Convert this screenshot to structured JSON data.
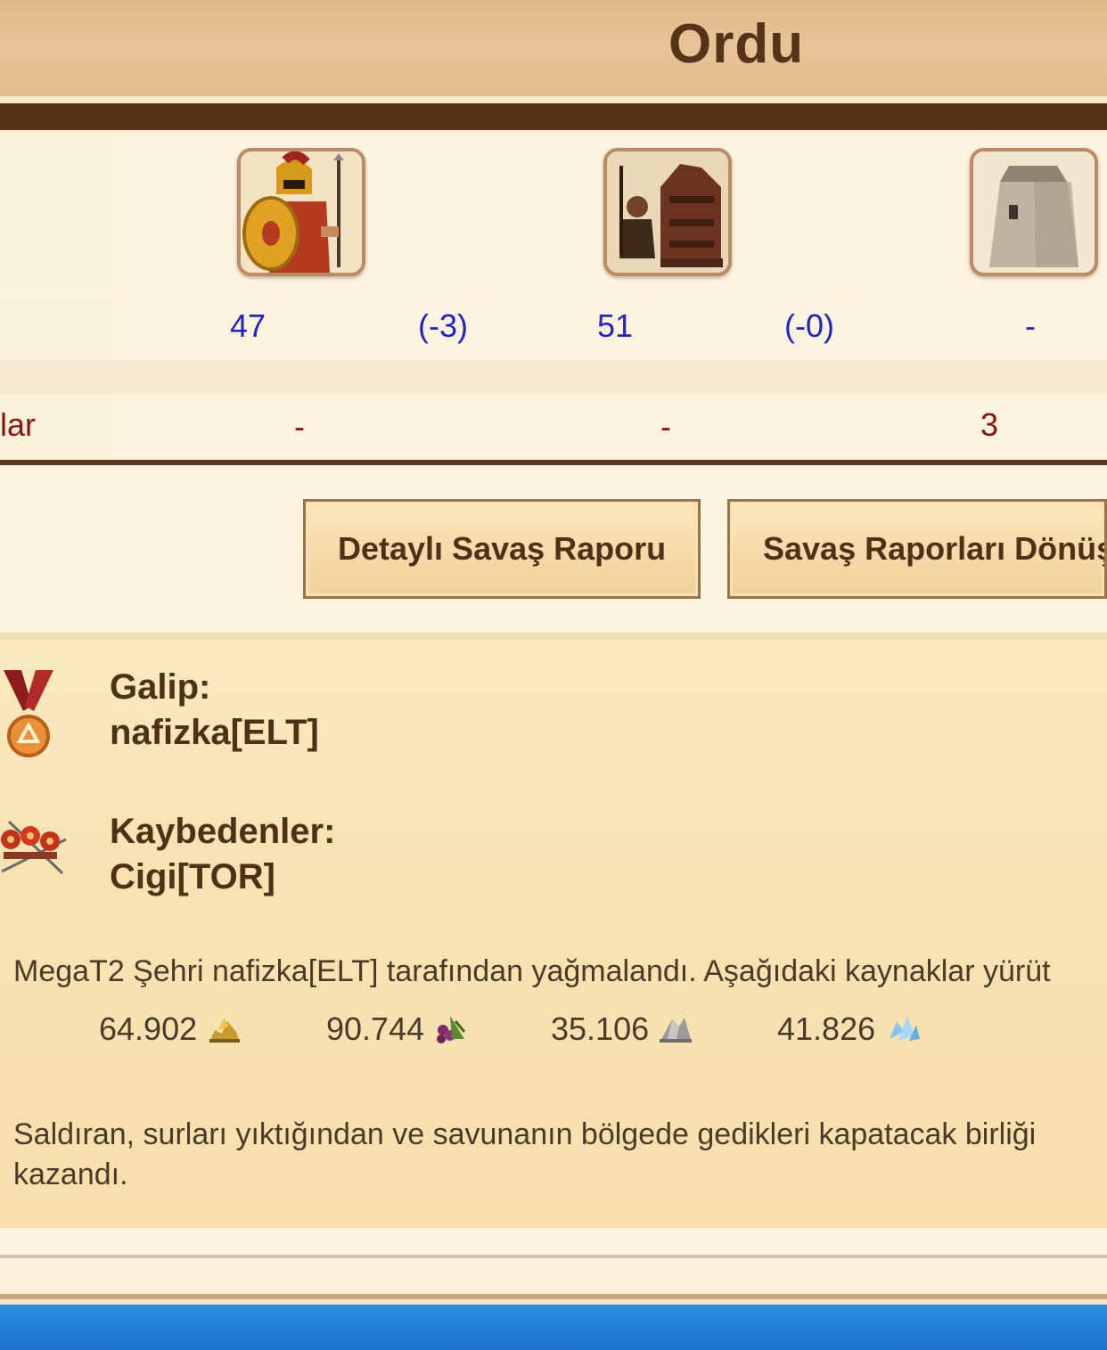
{
  "header": {
    "title": "Ordu"
  },
  "table": {
    "columns": [
      {
        "icon": "spartan-hoplite-icon",
        "count": "47",
        "loss": "(-3)",
        "destroyed": "-"
      },
      {
        "icon": "siege-tower-icon",
        "count": "51",
        "loss": "(-0)",
        "destroyed": "-"
      },
      {
        "icon": "city-wall-icon",
        "count": "-",
        "destroyed": "3"
      }
    ],
    "destroyed_row_label": "lar"
  },
  "buttons": {
    "detailed_report": "Detaylı Savaş Raporu",
    "back_to_reports": "Savaş Raporları Dönüş"
  },
  "result": {
    "winner_label": "Galip:",
    "winner_name": "nafizka[ELT]",
    "winner_icon": "medal-icon",
    "losers_label": "Kaybedenler:",
    "losers_name": "Cigi[TOR]",
    "losers_icon": "fallen-soldiers-icon",
    "plunder_text": "MegaT2 Şehri nafizka[ELT] tarafından yağmalandı. Aşağıdaki kaynaklar yürüt",
    "resources": [
      {
        "value": "64.902",
        "icon": "gold-icon"
      },
      {
        "value": "90.744",
        "icon": "wine-icon"
      },
      {
        "value": "35.106",
        "icon": "marble-icon"
      },
      {
        "value": "41.826",
        "icon": "crystal-icon"
      }
    ],
    "wall_text_line1": "Saldıran, surları yıktığından ve savunanın bölgede gedikleri kapatacak birliği",
    "wall_text_line2": "kazandı."
  }
}
